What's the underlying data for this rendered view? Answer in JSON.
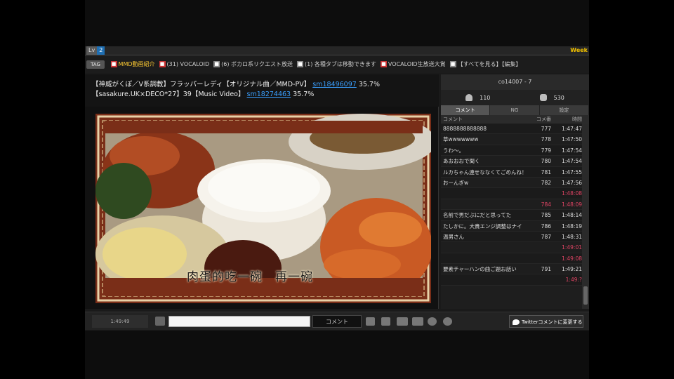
{
  "topstrip": {
    "level_label": "2",
    "ticker_text": "",
    "right_badge": "Week"
  },
  "tagbar": {
    "tag_button": "TAG",
    "tags": [
      {
        "text": "MMD動画紹介",
        "lock": true
      },
      {
        "text": "(31) VOCALOID",
        "lock": true
      },
      {
        "text": "(6) ボカロ系リクエスト放送",
        "lock": false
      },
      {
        "text": "(1) 各種タブは移動できます",
        "lock": false
      },
      {
        "text": "VOCALOID生放送大賞",
        "lock": true
      },
      {
        "text": "【すべてを見る】【編集】",
        "lock": false
      }
    ]
  },
  "info": {
    "line1_text": "【神威がくぽ／V系調教】フラッパーレディ【オリジナル曲／MMD-PV】",
    "line1_link": "sm18496097",
    "line1_pct": "35.7%",
    "line2_text": "【sasakure.UK×DECO*27】39【Music Video】",
    "line2_link": "sm18274463",
    "line2_pct": "35.7%"
  },
  "video": {
    "subtitle": "肉蛋的吃一碗　再一碗"
  },
  "side": {
    "title": "co14007 - 7",
    "visitors": "110",
    "comments": "530",
    "tabs": [
      "コメント",
      "NG",
      "設定"
    ],
    "headers": {
      "comment": "コメント",
      "num": "コメ番",
      "time": "時間"
    },
    "rows": [
      {
        "comment": "8888888888888",
        "num": "777",
        "time": "1:47:47",
        "hl": false
      },
      {
        "comment": "草wwwwwww",
        "num": "778",
        "time": "1:47:50",
        "hl": false
      },
      {
        "comment": "うわ～。",
        "num": "779",
        "time": "1:47:54",
        "hl": false
      },
      {
        "comment": "あおおおで聞く",
        "num": "780",
        "time": "1:47:54",
        "hl": false
      },
      {
        "comment": "ルカちゃん連せななくてごめんね！",
        "num": "781",
        "time": "1:47:55",
        "hl": false
      },
      {
        "comment": "おーんぎw",
        "num": "782",
        "time": "1:47:56",
        "hl": false
      },
      {
        "comment": "",
        "num": "",
        "time": "1:48:08",
        "hl": true
      },
      {
        "comment": "",
        "num": "784",
        "time": "1:48:09",
        "hl": true
      },
      {
        "comment": "名前で男だぶにだと思ってた",
        "num": "785",
        "time": "1:48:14",
        "hl": false
      },
      {
        "comment": "たしかに。大貴エンジ調整はナイ",
        "num": "786",
        "time": "1:48:19",
        "hl": false
      },
      {
        "comment": "温男さん",
        "num": "787",
        "time": "1:48:31",
        "hl": false
      },
      {
        "comment": "",
        "num": "",
        "time": "1:49:01",
        "hl": true
      },
      {
        "comment": "",
        "num": "",
        "time": "1:49:08",
        "hl": true
      },
      {
        "comment": "要素チャーハンの曲ご題お話い",
        "num": "791",
        "time": "1:49:21",
        "hl": false
      },
      {
        "comment": "",
        "num": "",
        "time": "1:49:?",
        "hl": true
      }
    ]
  },
  "controls": {
    "time": "1:49:49",
    "comment_placeholder": "",
    "comment_button": "コメント",
    "twitter_label": "Twitterコメントに変更する"
  },
  "colors": {
    "accent_link": "#3aa0ff",
    "highlight_comment": "#e04464",
    "badge_yellow": "#f0c000"
  }
}
